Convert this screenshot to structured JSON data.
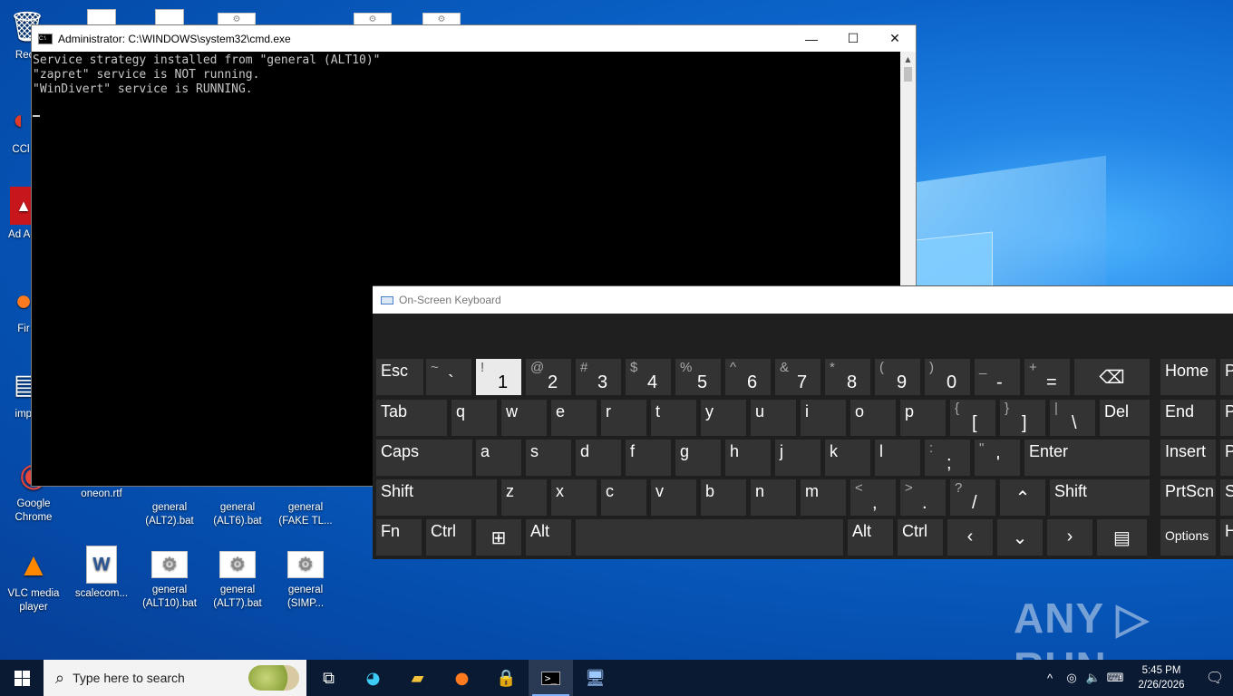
{
  "desktop": {
    "icons": [
      {
        "label": "Recy",
        "glyph": "🗑"
      },
      {
        "label": "CCl",
        "glyph": "◐"
      },
      {
        "label": "Ad Acr",
        "glyph": "▲"
      },
      {
        "label": "Fir",
        "glyph": "●"
      },
      {
        "label": "impo",
        "glyph": "▤"
      },
      {
        "label": "Google Chrome",
        "glyph": "◉"
      },
      {
        "label": "oneon.rtf"
      },
      {
        "label": "general (ALT2).bat"
      },
      {
        "label": "general (ALT6).bat"
      },
      {
        "label": "general (FAKE TL..."
      },
      {
        "label": "VLC media player",
        "glyph": "▲"
      },
      {
        "label": "scalecom..."
      },
      {
        "label": "general (ALT10).bat"
      },
      {
        "label": "general (ALT7).bat"
      },
      {
        "label": "general (SIMP..."
      }
    ]
  },
  "cmd": {
    "title": "Administrator: C:\\WINDOWS\\system32\\cmd.exe",
    "app_icon": "C:\\",
    "lines": [
      "Service strategy installed from \"general (ALT10)\"",
      "\"zapret\" service is NOT running.",
      "\"WinDivert\" service is RUNNING."
    ],
    "minimize_glyph": "—",
    "maximize_glyph": "☐",
    "close_glyph": "✕"
  },
  "osk": {
    "title": "On-Screen Keyboard",
    "rows": {
      "row1": [
        {
          "label": "Esc"
        },
        {
          "shift": "~",
          "main": "`"
        },
        {
          "shift": "!",
          "main": "1"
        },
        {
          "shift": "@",
          "main": "2"
        },
        {
          "shift": "#",
          "main": "3"
        },
        {
          "shift": "$",
          "main": "4"
        },
        {
          "shift": "%",
          "main": "5"
        },
        {
          "shift": "^",
          "main": "6"
        },
        {
          "shift": "&",
          "main": "7"
        },
        {
          "shift": "*",
          "main": "8"
        },
        {
          "shift": "(",
          "main": "9"
        },
        {
          "shift": ")",
          "main": "0"
        },
        {
          "shift": "_",
          "main": "-"
        },
        {
          "shift": "+",
          "main": "="
        },
        {
          "label": "⌫"
        },
        {
          "label": "Home"
        },
        {
          "label": "P"
        }
      ],
      "row2": [
        {
          "label": "Tab"
        },
        {
          "label": "q"
        },
        {
          "label": "w"
        },
        {
          "label": "e"
        },
        {
          "label": "r"
        },
        {
          "label": "t"
        },
        {
          "label": "y"
        },
        {
          "label": "u"
        },
        {
          "label": "i"
        },
        {
          "label": "o"
        },
        {
          "label": "p"
        },
        {
          "shift": "{",
          "main": "["
        },
        {
          "shift": "}",
          "main": "]"
        },
        {
          "shift": "|",
          "main": "\\"
        },
        {
          "label": "Del"
        },
        {
          "label": "End"
        },
        {
          "label": "P"
        }
      ],
      "row3": [
        {
          "label": "Caps"
        },
        {
          "label": "a"
        },
        {
          "label": "s"
        },
        {
          "label": "d"
        },
        {
          "label": "f"
        },
        {
          "label": "g"
        },
        {
          "label": "h"
        },
        {
          "label": "j"
        },
        {
          "label": "k"
        },
        {
          "label": "l"
        },
        {
          "shift": ":",
          "main": ";"
        },
        {
          "shift": "\"",
          "main": "'"
        },
        {
          "label": "Enter"
        },
        {
          "label": "Insert"
        },
        {
          "label": "P"
        }
      ],
      "row4": [
        {
          "label": "Shift"
        },
        {
          "label": "z"
        },
        {
          "label": "x"
        },
        {
          "label": "c"
        },
        {
          "label": "v"
        },
        {
          "label": "b"
        },
        {
          "label": "n"
        },
        {
          "label": "m"
        },
        {
          "shift": "<",
          "main": ","
        },
        {
          "shift": ">",
          "main": "."
        },
        {
          "shift": "?",
          "main": "/"
        },
        {
          "label": "⌃"
        },
        {
          "label": "Shift"
        },
        {
          "label": "PrtScn"
        },
        {
          "label": "S"
        }
      ],
      "row5": [
        {
          "label": "Fn"
        },
        {
          "label": "Ctrl"
        },
        {
          "label": "⊞"
        },
        {
          "label": "Alt"
        },
        {
          "label": ""
        },
        {
          "label": "Alt"
        },
        {
          "label": "Ctrl"
        },
        {
          "label": "‹"
        },
        {
          "label": "⌄"
        },
        {
          "label": "›"
        },
        {
          "label": "▤"
        },
        {
          "label": "Options"
        },
        {
          "label": "H"
        }
      ]
    }
  },
  "taskbar": {
    "search_placeholder": "Type here to search",
    "apps": [
      "task-view",
      "edge",
      "file-explorer",
      "firefox",
      "lock-app",
      "cmd",
      "network-app"
    ],
    "tray": {
      "chevron": "^",
      "time": "5:45 PM",
      "date": "2/26/2026"
    }
  },
  "watermark": "ANY ▷ RUN"
}
